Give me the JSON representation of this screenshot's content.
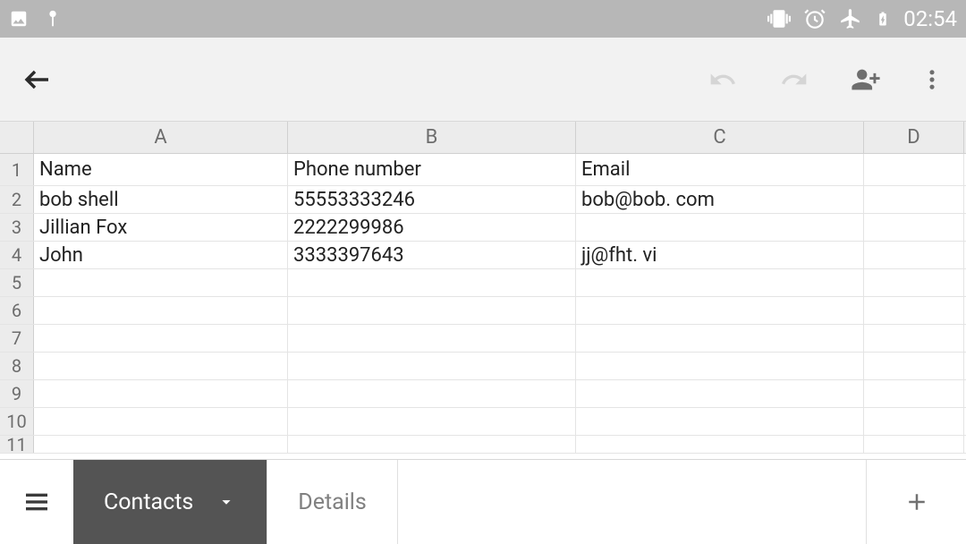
{
  "status": {
    "time": "02:54"
  },
  "columns": [
    "A",
    "B",
    "C",
    "D"
  ],
  "rows": [
    "1",
    "2",
    "3",
    "4",
    "5",
    "6",
    "7",
    "8",
    "9",
    "10",
    "11"
  ],
  "cells": {
    "r0": {
      "A": "Name",
      "B": "Phone number",
      "C": "Email",
      "D": ""
    },
    "r1": {
      "A": "bob shell",
      "B": "55553333246",
      "C": "bob@bob. com",
      "D": ""
    },
    "r2": {
      "A": "Jillian Fox",
      "B": "2222299986",
      "C": "",
      "D": ""
    },
    "r3": {
      "A": "John",
      "B": "3333397643",
      "C": "jj@fht. vi",
      "D": ""
    },
    "r4": {
      "A": "",
      "B": "",
      "C": "",
      "D": ""
    },
    "r5": {
      "A": "",
      "B": "",
      "C": "",
      "D": ""
    },
    "r6": {
      "A": "",
      "B": "",
      "C": "",
      "D": ""
    },
    "r7": {
      "A": "",
      "B": "",
      "C": "",
      "D": ""
    },
    "r8": {
      "A": "",
      "B": "",
      "C": "",
      "D": ""
    },
    "r9": {
      "A": "",
      "B": "",
      "C": "",
      "D": ""
    },
    "r10": {
      "A": "",
      "B": "",
      "C": "",
      "D": ""
    }
  },
  "tabs": {
    "active": "Contacts",
    "other": "Details"
  }
}
